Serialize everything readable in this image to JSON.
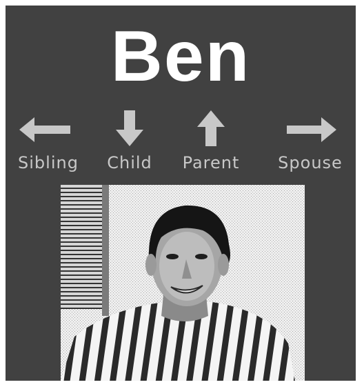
{
  "person": {
    "name": "Ben"
  },
  "nav": {
    "sibling_label": "Sibling",
    "child_label": "Child",
    "parent_label": "Parent",
    "spouse_label": "Spouse"
  },
  "icons": {
    "sibling": "arrow-left-icon",
    "child": "arrow-down-icon",
    "parent": "arrow-up-icon",
    "spouse": "arrow-right-icon"
  },
  "colors": {
    "panel_background": "#414141",
    "name_text": "#ffffff",
    "arrow_fill": "#c8c8c8"
  }
}
